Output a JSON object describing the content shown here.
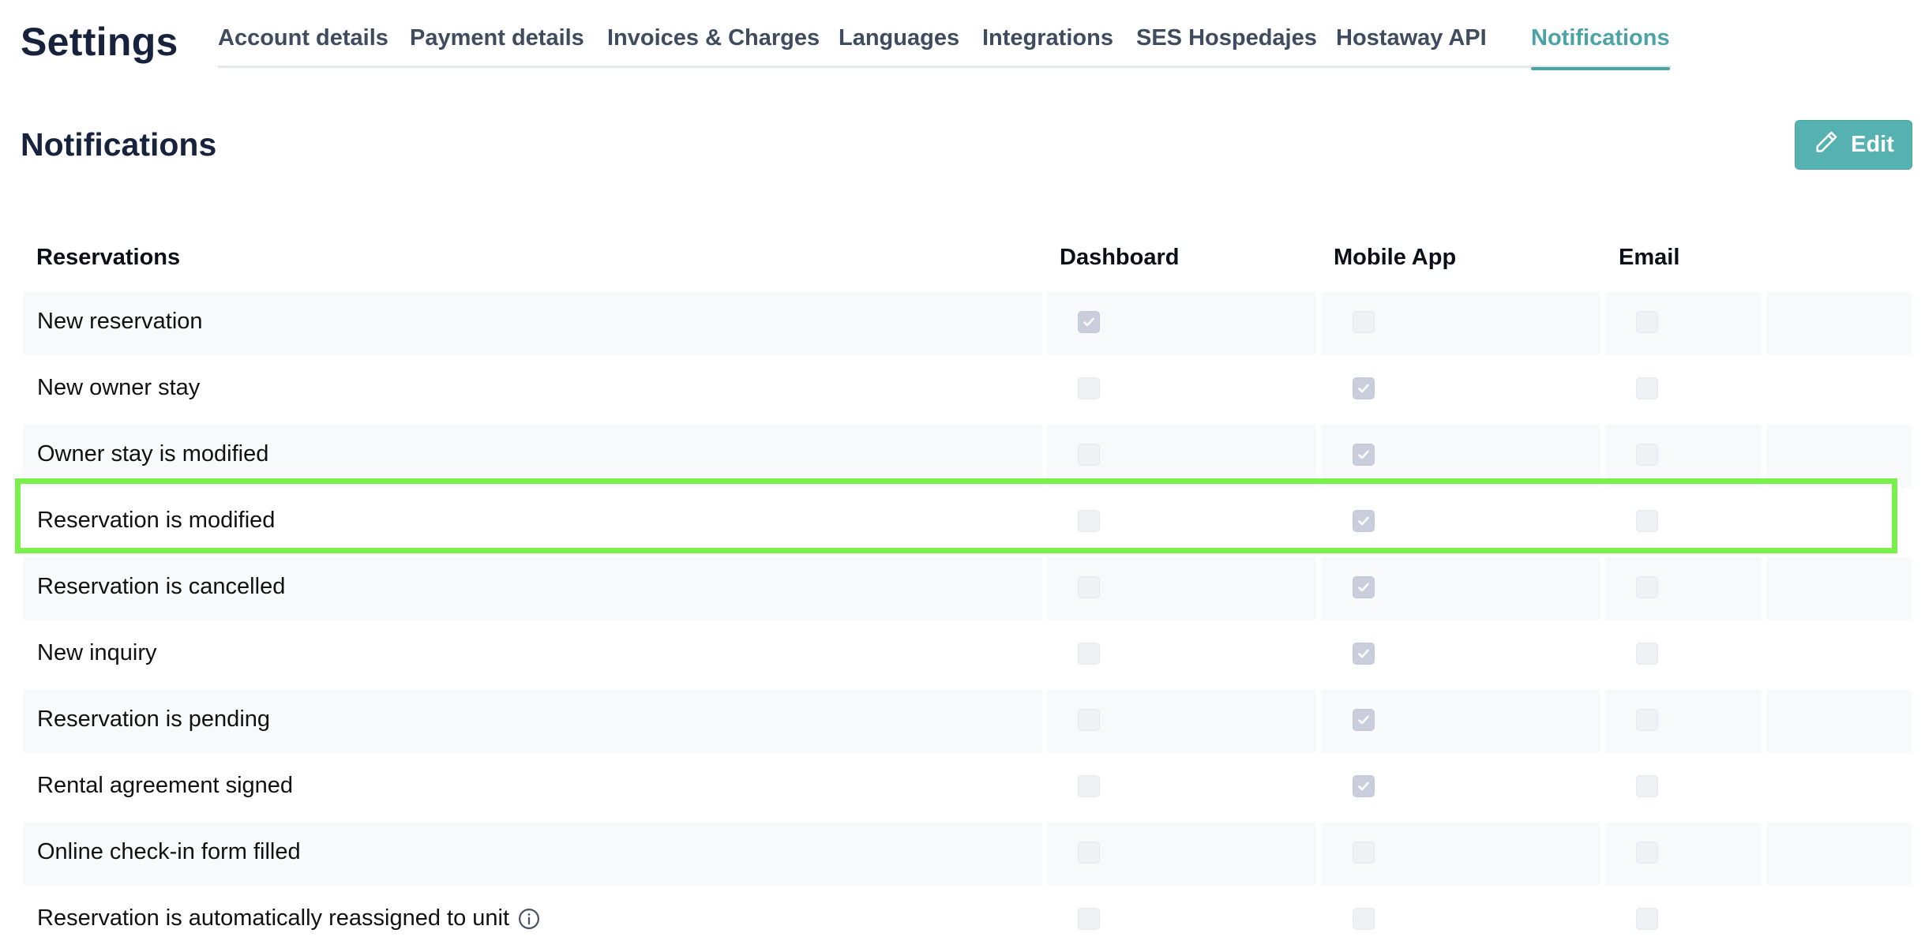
{
  "header": {
    "title": "Settings",
    "tabs": [
      {
        "label": "Account details",
        "active": false
      },
      {
        "label": "Payment details",
        "active": false
      },
      {
        "label": "Invoices & Charges",
        "active": false
      },
      {
        "label": "Languages",
        "active": false
      },
      {
        "label": "Integrations",
        "active": false
      },
      {
        "label": "SES Hospedajes",
        "active": false
      },
      {
        "label": "Hostaway API",
        "active": false
      },
      {
        "label": "Notifications",
        "active": true
      }
    ]
  },
  "section": {
    "title": "Notifications",
    "edit_label": "Edit"
  },
  "table": {
    "columns": [
      "Reservations",
      "Dashboard",
      "Mobile App",
      "Email"
    ],
    "rows": [
      {
        "label": "New reservation",
        "dashboard": true,
        "mobile_app": false,
        "email": false
      },
      {
        "label": "New owner stay",
        "dashboard": false,
        "mobile_app": true,
        "email": false
      },
      {
        "label": "Owner stay is modified",
        "dashboard": false,
        "mobile_app": true,
        "email": false
      },
      {
        "label": "Reservation is modified",
        "dashboard": false,
        "mobile_app": true,
        "email": false
      },
      {
        "label": "Reservation is cancelled",
        "dashboard": false,
        "mobile_app": true,
        "email": false
      },
      {
        "label": "New inquiry",
        "dashboard": false,
        "mobile_app": true,
        "email": false
      },
      {
        "label": "Reservation is pending",
        "dashboard": false,
        "mobile_app": true,
        "email": false
      },
      {
        "label": "Rental agreement signed",
        "dashboard": false,
        "mobile_app": true,
        "email": false
      },
      {
        "label": "Online check-in form filled",
        "dashboard": false,
        "mobile_app": false,
        "email": false
      },
      {
        "label": "Reservation is automatically reassigned to unit",
        "dashboard": false,
        "mobile_app": false,
        "email": false
      }
    ]
  },
  "colors": {
    "accent": "#4aa3a5",
    "button": "#56b1b1",
    "highlight": "#7af04d",
    "heading": "#17233d"
  },
  "icons": {
    "edit": "pencil-icon",
    "info": "info-icon",
    "check": "check-icon"
  }
}
